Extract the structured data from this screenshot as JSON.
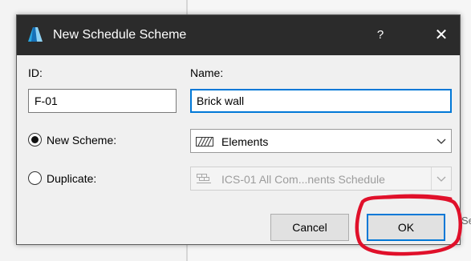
{
  "background": {
    "peek_text": "Se"
  },
  "dialog": {
    "title": "New Schedule Scheme",
    "help_label": "?",
    "close_label": "✕",
    "id_label": "ID:",
    "id_value": "F-01",
    "name_label": "Name:",
    "name_value": "Brick wall",
    "new_scheme_label": "New Scheme:",
    "new_scheme_selected": true,
    "new_scheme_value": "Elements",
    "duplicate_label": "Duplicate:",
    "duplicate_selected": false,
    "duplicate_value": "ICS-01 All Com...nents Schedule",
    "cancel_label": "Cancel",
    "ok_label": "OK"
  },
  "colors": {
    "titlebar": "#2b2b2b",
    "accent_blue": "#0078d7",
    "annotation_red": "#e0102a",
    "dialog_bg": "#f0f0f0"
  },
  "icons": {
    "app": "archicad-logo-icon",
    "elements": "hatched-element-icon",
    "duplicate": "schedule-table-icon",
    "dropdown": "chevron-down-icon"
  }
}
